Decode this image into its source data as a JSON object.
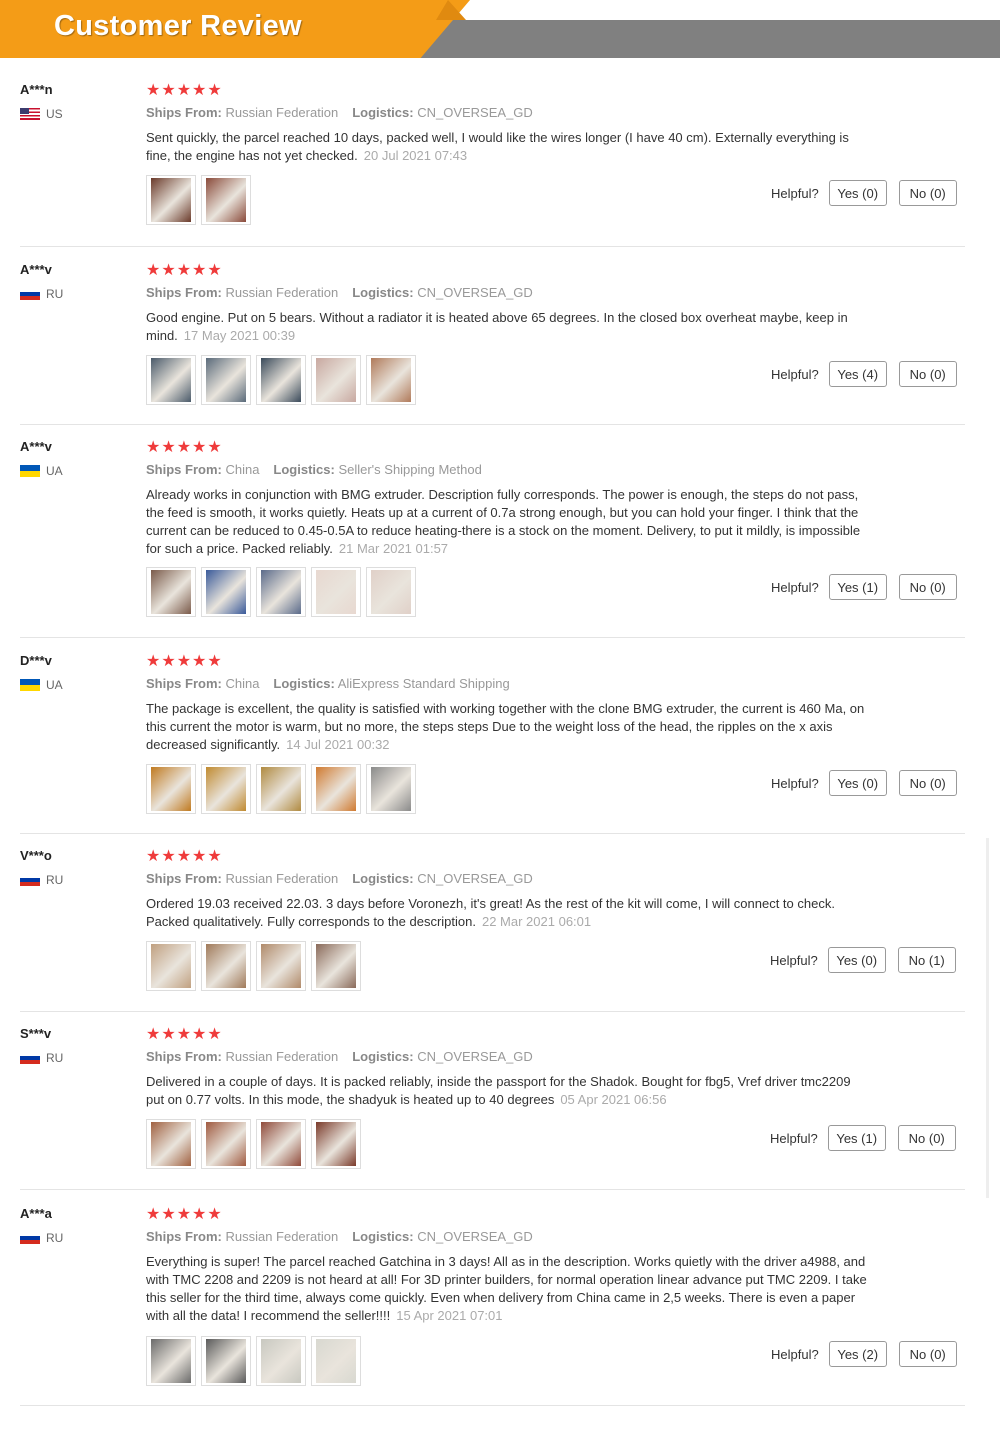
{
  "header": {
    "title": "Customer Review"
  },
  "labels": {
    "ships_from": "Ships From:",
    "logistics": "Logistics:",
    "helpful": "Helpful?"
  },
  "colors": {
    "accent_orange": "#f49c17",
    "header_grey": "#808080",
    "star_red": "#ef3b3b"
  },
  "reviews": [
    {
      "user": "A***n",
      "flag": "flag-us",
      "country": "US",
      "stars": 5,
      "ships_from": "Russian Federation",
      "logistics": "CN_OVERSEA_GD",
      "text": "Sent quickly, the parcel reached 10 days, packed well, I would like the wires longer (I have 40 cm). Externally everything is fine, the engine has not yet checked.",
      "date": "20 Jul 2021 07:43",
      "yes": "Yes (0)",
      "no": "No (0)",
      "images": [
        "#6a3a2a",
        "#8a4a3a"
      ]
    },
    {
      "user": "A***v",
      "flag": "flag-ru",
      "country": "RU",
      "stars": 5,
      "ships_from": "Russian Federation",
      "logistics": "CN_OVERSEA_GD",
      "text": "Good engine. Put on 5 bears. Without a radiator it is heated above 65 degrees. In the closed box overheat maybe, keep in mind.",
      "date": "17 May 2021 00:39",
      "yes": "Yes (4)",
      "no": "No (0)",
      "images": [
        "#4a5a6a",
        "#5a6a7a",
        "#3a4a5a",
        "#c8a8a0",
        "#b07a5a"
      ]
    },
    {
      "user": "A***v",
      "flag": "flag-ua",
      "country": "UA",
      "stars": 5,
      "ships_from": "China",
      "logistics": "Seller's Shipping Method",
      "text": "Already works in conjunction with BMG extruder. Description fully corresponds. The power is enough, the steps do not pass, the feed is smooth, it works quietly. Heats up at a current of 0.7a strong enough, but you can hold your finger. I think that the current can be reduced to 0.45-0.5A to reduce heating-there is a stock on the moment. Delivery, to put it mildly, is impossible for such a price. Packed reliably.",
      "date": "21 Mar 2021 01:57",
      "yes": "Yes (1)",
      "no": "No (0)",
      "images": [
        "#7a5a4a",
        "#3a5a9a",
        "#5a6a8a",
        "#e8d8d0",
        "#e0d0c8"
      ]
    },
    {
      "user": "D***v",
      "flag": "flag-ua",
      "country": "UA",
      "stars": 5,
      "ships_from": "China",
      "logistics": "AliExpress Standard Shipping",
      "text": "The package is excellent, the quality is satisfied with working together with the clone BMG extruder, the current is 460 Ma, on this current the motor is warm, but no more, the steps steps Due to the weight loss of the head, the ripples on the x axis decreased significantly.",
      "date": "14 Jul 2021 00:32",
      "yes": "Yes (0)",
      "no": "No (0)",
      "images": [
        "#c07a20",
        "#c08a30",
        "#b08a40",
        "#d07a30",
        "#8a8a8a"
      ]
    },
    {
      "user": "V***o",
      "flag": "flag-ru",
      "country": "RU",
      "stars": 5,
      "ships_from": "Russian Federation",
      "logistics": "CN_OVERSEA_GD",
      "text": "Ordered 19.03 received 22.03. 3 days before Voronezh, it's great! As the rest of the kit will come, I will connect to check. Packed qualitatively. Fully corresponds to the description.",
      "date": "22 Mar 2021 06:01",
      "yes": "Yes (0)",
      "no": "No (1)",
      "images": [
        "#c0a080",
        "#a07a5a",
        "#b08a6a",
        "#8a6a5a"
      ]
    },
    {
      "user": "S***v",
      "flag": "flag-ru",
      "country": "RU",
      "stars": 5,
      "ships_from": "Russian Federation",
      "logistics": "CN_OVERSEA_GD",
      "text": "Delivered in a couple of days. It is packed reliably, inside the passport for the Shadok. Bought for fbg5, Vref driver tmc2209 put on 0.77 volts. In this mode, the shadyuk is heated up to 40 degrees",
      "date": "05 Apr 2021 06:56",
      "yes": "Yes (1)",
      "no": "No (0)",
      "images": [
        "#a06040",
        "#a05a40",
        "#904a3a",
        "#7a3a2a"
      ]
    },
    {
      "user": "A***a",
      "flag": "flag-ru",
      "country": "RU",
      "stars": 5,
      "ships_from": "Russian Federation",
      "logistics": "CN_OVERSEA_GD",
      "text": "Everything is super! The parcel reached Gatchina in 3 days! All as in the description. Works quietly with the driver a4988, and with TMC 2208 and 2209 is not heard at all! For 3D printer builders, for normal operation linear advance put TMC 2209. I take this seller for the third time, always come quickly. Even when delivery from China came in 2,5 weeks. There is even a paper with all the data! I recommend the seller!!!!",
      "date": "15 Apr 2021 07:01",
      "yes": "Yes (2)",
      "no": "No (0)",
      "images": [
        "#6a6a6a",
        "#5a5a5a",
        "#c8c8c0",
        "#d8d8d0"
      ]
    }
  ]
}
